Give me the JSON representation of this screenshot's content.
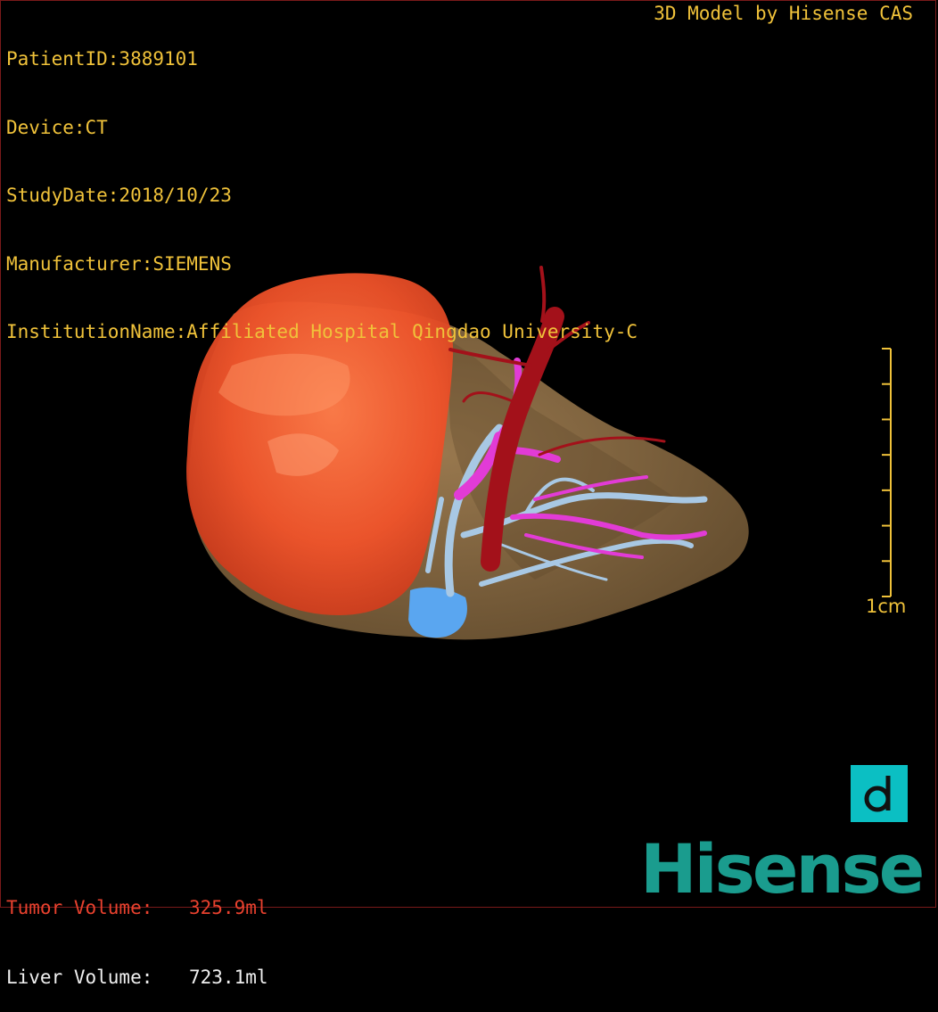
{
  "metadata": {
    "patient_id": "PatientID:3889101",
    "device": "Device:CT",
    "study_date": "StudyDate:2018/10/23",
    "manufacturer": "Manufacturer:SIEMENS",
    "institution": "InstitutionName:Affiliated Hospital Qingdao University-C"
  },
  "credit": "3D Model by Hisense CAS",
  "scale_bar": {
    "label": "1cm",
    "ticks": 8,
    "color": "#f0c23a"
  },
  "volumes": {
    "tumor": {
      "label": "Tumor Volume:",
      "value": "325.9ml",
      "color": "#e8412e"
    },
    "liver": {
      "label": "Liver Volume:",
      "value": "723.1ml",
      "color": "#f0f0f0"
    }
  },
  "brand": {
    "name": "Hisense",
    "color": "#1a9c8e",
    "badge_icon": "d-letter-icon",
    "badge_color": "#0bbfc3"
  },
  "colors": {
    "text": "#f0c23a",
    "liver": "#8a6c45",
    "tumor": "#f0532a",
    "artery": "#a3111a",
    "portal_vein": "#e23bd6",
    "hepatic_vein": "#a8c8e4",
    "ivc": "#5aa6f0"
  }
}
